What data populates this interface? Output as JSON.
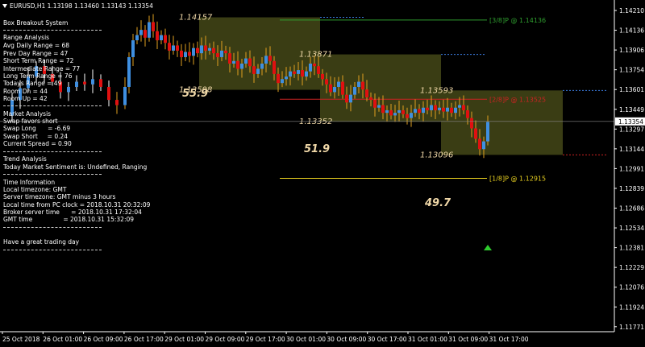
{
  "window": {
    "symbol_label": "EURUSD,H1  1.13198 1.13460 1.13143 1.13354"
  },
  "colors": {
    "background": "#000000",
    "bull": "#3f8fe0",
    "bear": "#e01010",
    "box": "#3a3d14",
    "box_label": "#f0d8a8",
    "level_green": "#2f9e2f",
    "level_red": "#cc2222",
    "level_yellow": "#e8d020",
    "dotted_blue": "#3b7be0",
    "wick_yellow": "#e0a020"
  },
  "info_panel": {
    "title": "Box Breakout System",
    "range_header": "Range Analysis",
    "avg_daily": "Avg Daily Range = 68",
    "prev_day": "Prev Day Range = 47",
    "short_term": "Short Term Range = 72",
    "intermediate": "Intermediate Range = 77",
    "long_term": "Long Term Range = 76",
    "todays": "Todays Range = 49",
    "room_dn": "Room Dn = 44",
    "room_up": "Room Up = 42",
    "market_header": "Market Analysis",
    "swap_favors": "Swap favors short",
    "swap_long": "Swap Long      = -6.69",
    "swap_short": "Swap Short     = 0.24",
    "current_spread": "Current Spread = 0.90",
    "trend_header": "Trend Analysis",
    "trend_text": "Today Market Sentiment is: Undefined, Ranging",
    "time_header": "Time Information",
    "local_tz": "Local timezone: GMT",
    "server_tz": "Server timezone: GMT minus 3 hours",
    "local_time": "Local time from PC clock = 2018.10.31 20:32:09",
    "broker_time": "Broker server time      = 2018.10.31 17:32:04",
    "gmt_time": "GMT time                = 2018.10.31 15:32:09",
    "farewell": "Have a great trading day"
  },
  "boxes": [
    {
      "high_label": "1.14157",
      "low_label": "1.13598",
      "range_label": "55.9"
    },
    {
      "high_label": "1.13871",
      "low_label": "1.13352",
      "range_label": "51.9"
    },
    {
      "high_label": "1.13593",
      "low_label": "1.13096",
      "range_label": "49.7"
    }
  ],
  "levels": [
    {
      "label": "[3/8]P @ 1.14136"
    },
    {
      "label": "[2/8]P @ 1.13525"
    },
    {
      "label": "[1/8]P @ 1.12915"
    }
  ],
  "price_axis": {
    "ticks": [
      "1.14210",
      "1.14136",
      "1.13906",
      "1.13754",
      "1.13601",
      "1.13449",
      "1.13297",
      "1.13144",
      "1.12991",
      "1.12839",
      "1.12686",
      "1.12534",
      "1.12381",
      "1.12229",
      "1.12076",
      "1.11924",
      "1.11771"
    ],
    "current_price": "1.13354"
  },
  "time_axis": {
    "ticks": [
      "25 Oct 2018",
      "26 Oct 01:00",
      "26 Oct 09:00",
      "26 Oct 17:00",
      "29 Oct 01:00",
      "29 Oct 09:00",
      "29 Oct 17:00",
      "30 Oct 01:00",
      "30 Oct 09:00",
      "30 Oct 17:00",
      "31 Oct 01:00",
      "31 Oct 09:00",
      "31 Oct 17:00"
    ]
  }
}
